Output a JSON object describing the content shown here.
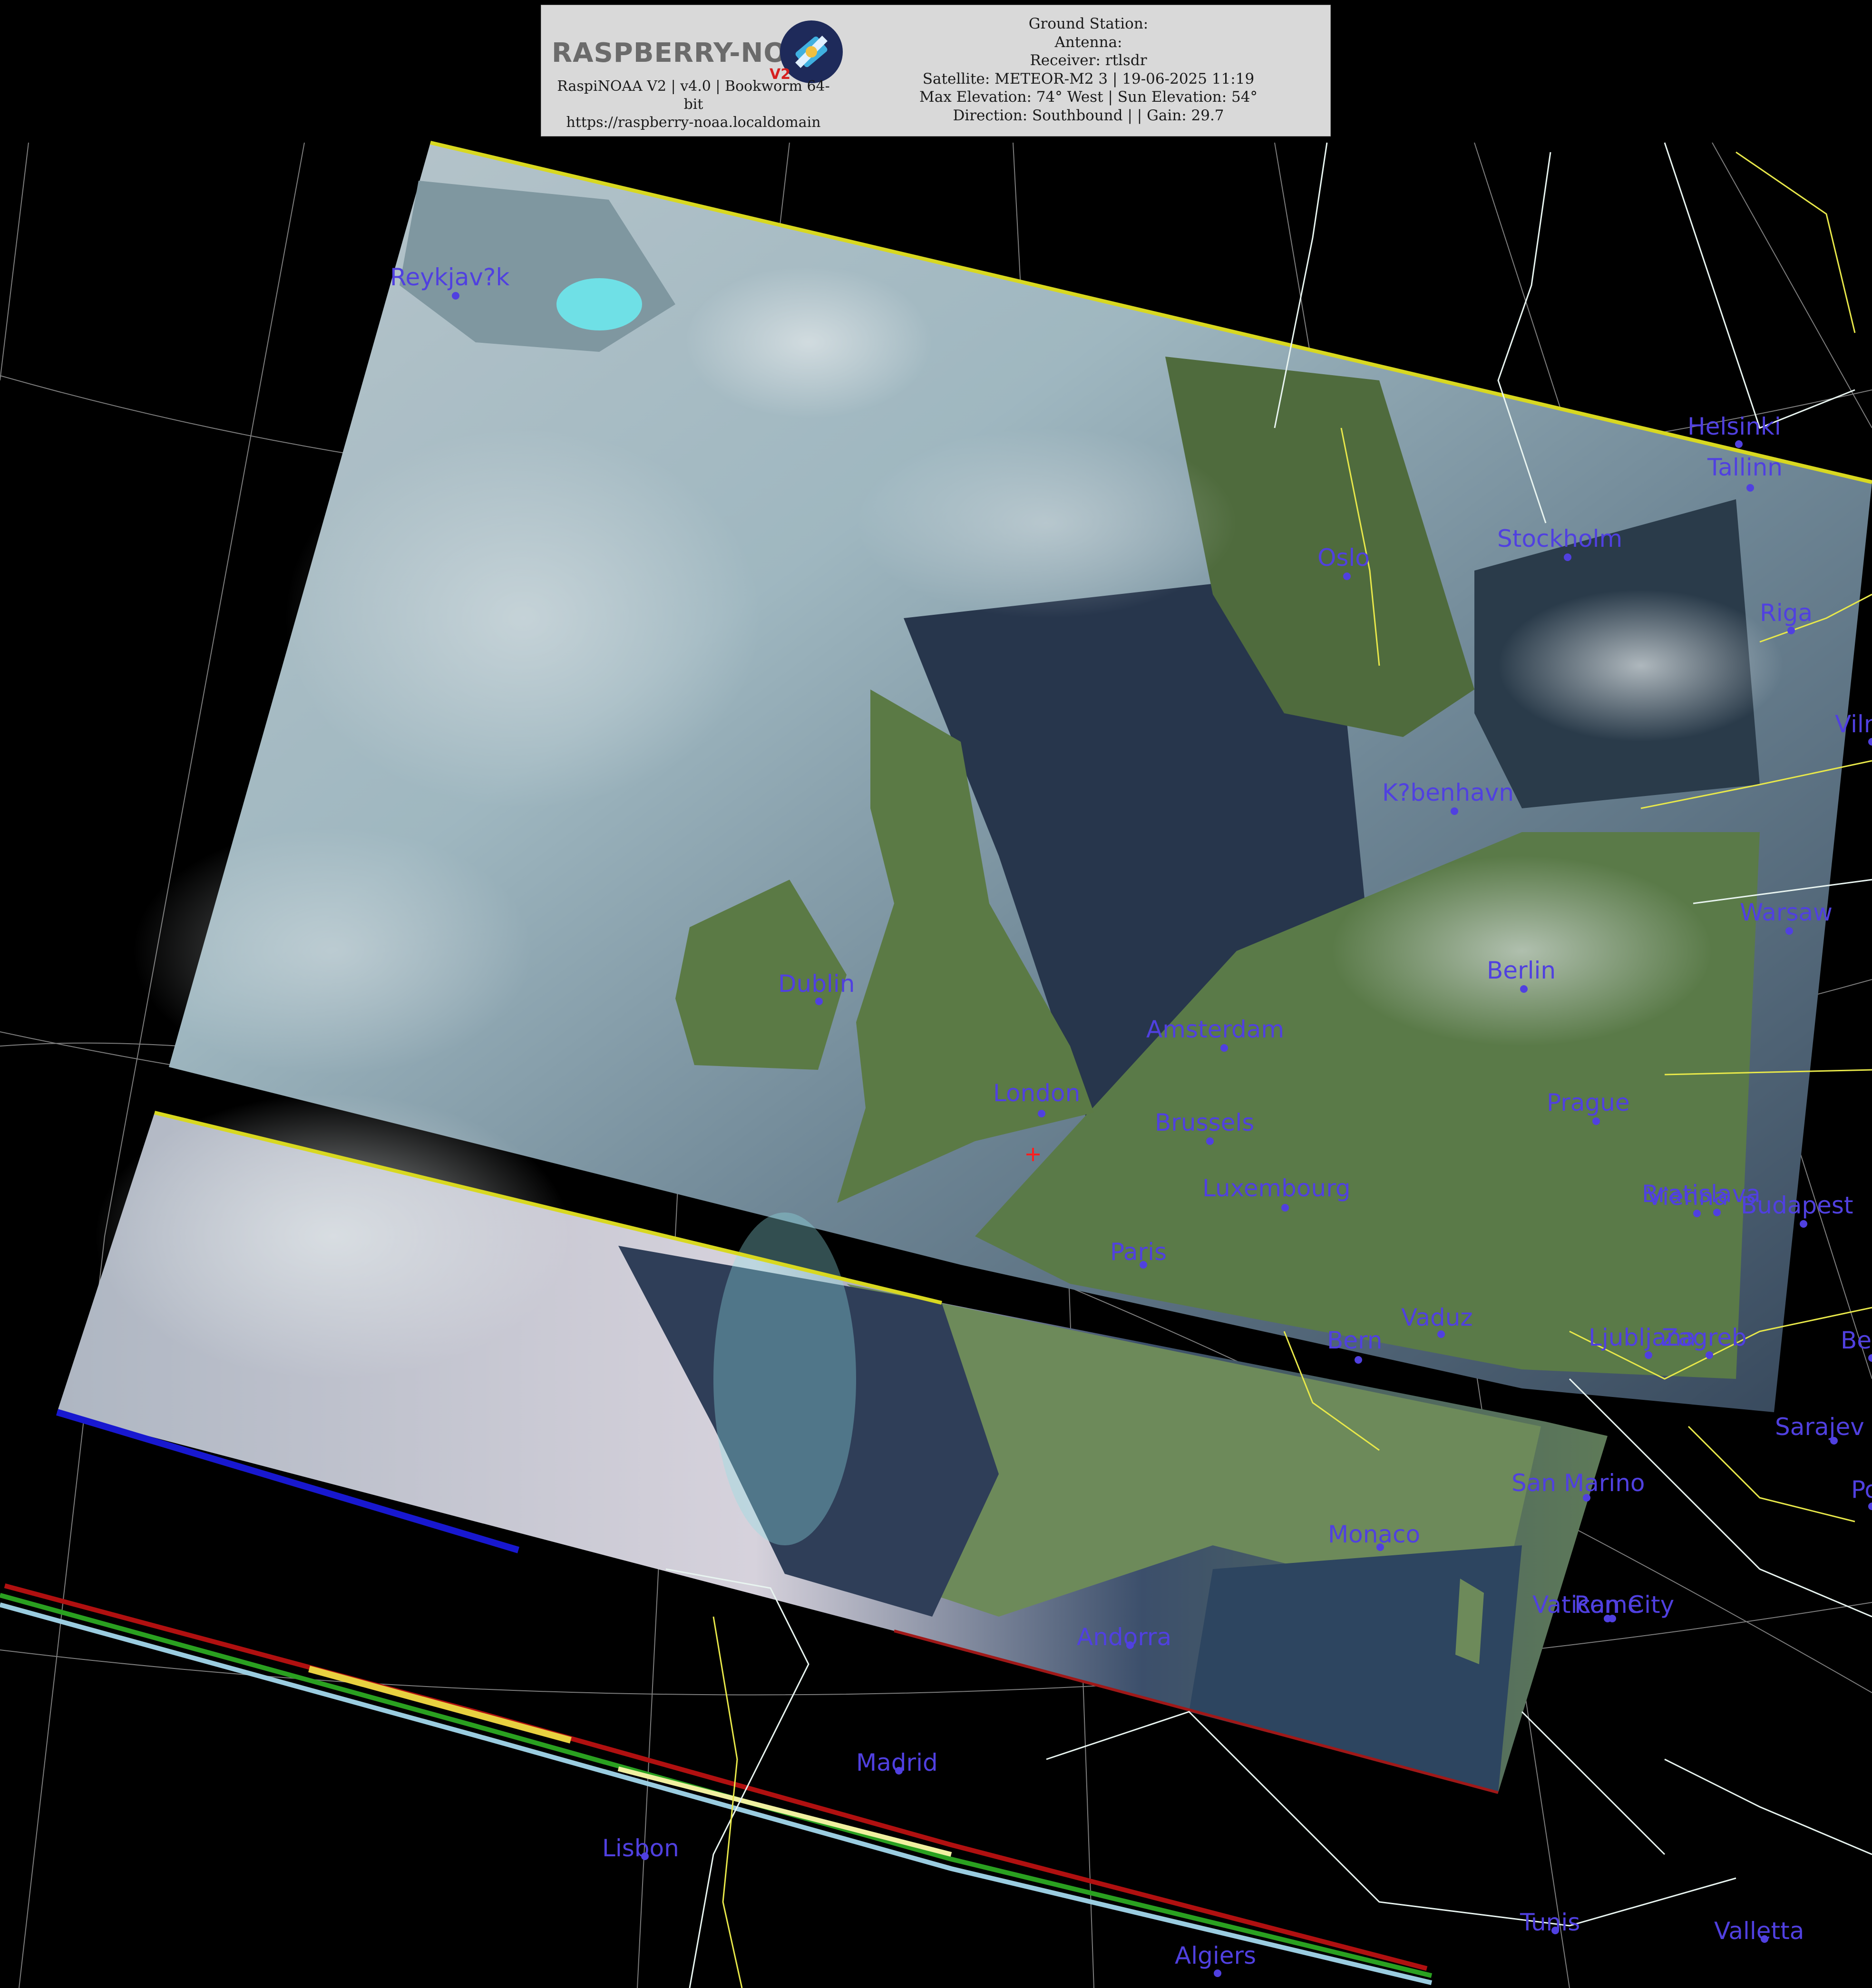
{
  "header": {
    "logo_text": "RASPBERRY-NOAA",
    "logo_badge": "V2",
    "left_lines": [
      "RaspiNOAA V2 | v4.0 | Bookworm 64-",
      "bit",
      "https://raspberry-noaa.localdomain"
    ],
    "right_lines": [
      "Ground Station:",
      "Antenna:",
      "Receiver: rtlsdr",
      "Satellite: METEOR-M2 3 | 19-06-2025 11:19",
      "Max Elevation: 74° West | Sun Elevation: 54°",
      "Direction: Southbound | | Gain: 29.7"
    ]
  },
  "cities": [
    {
      "name": "Reykjav?k"
    },
    {
      "name": "Helsinki"
    },
    {
      "name": "Tallinn"
    },
    {
      "name": "Stockholm"
    },
    {
      "name": "Oslo"
    },
    {
      "name": "Riga"
    },
    {
      "name": "Viln"
    },
    {
      "name": "K?benhavn"
    },
    {
      "name": "Warsaw"
    },
    {
      "name": "Berlin"
    },
    {
      "name": "Dublin"
    },
    {
      "name": "Amsterdam"
    },
    {
      "name": "London"
    },
    {
      "name": "Brussels"
    },
    {
      "name": "Prague"
    },
    {
      "name": "Luxembourg"
    },
    {
      "name": "Bratislava"
    },
    {
      "name": "Vienna"
    },
    {
      "name": "Budapest"
    },
    {
      "name": "Paris"
    },
    {
      "name": "Vaduz"
    },
    {
      "name": "Bern"
    },
    {
      "name": "Ljubljana"
    },
    {
      "name": "Zagreb"
    },
    {
      "name": "Be"
    },
    {
      "name": "Sarajev"
    },
    {
      "name": "San Marino"
    },
    {
      "name": "Pod"
    },
    {
      "name": "Monaco"
    },
    {
      "name": "Vatican City"
    },
    {
      "name": "Rome"
    },
    {
      "name": "Andorra"
    },
    {
      "name": "Madrid"
    },
    {
      "name": "Lisbon"
    },
    {
      "name": "Tunis"
    },
    {
      "name": "Valletta"
    },
    {
      "name": "Algiers"
    }
  ],
  "colors": {
    "background": "#000000",
    "city_label": "#5040e0",
    "coastline": "#e8f4f0",
    "border": "#e8e84a",
    "graticule": "#b0b0b0",
    "header_bg": "#d9d9d9"
  }
}
